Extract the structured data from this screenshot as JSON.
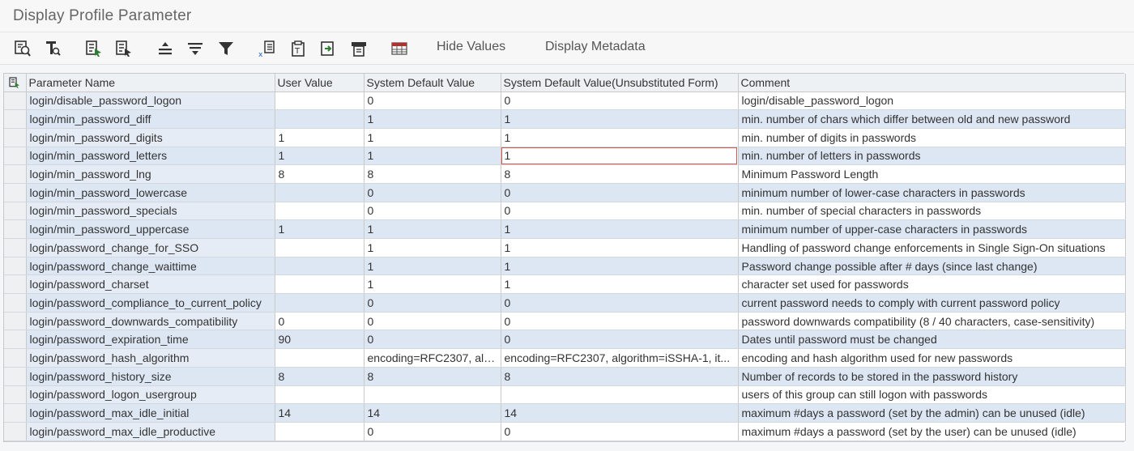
{
  "window": {
    "title": "Display Profile Parameter"
  },
  "toolbar": {
    "icons": [
      "details-icon",
      "text-search-icon",
      "select-layout-icon",
      "choose-layout-icon",
      "sort-ascending-icon",
      "sort-descending-icon",
      "filter-icon",
      "export-excel-icon",
      "print-preview-icon",
      "export-file-icon",
      "print-icon",
      "spreadsheet-icon"
    ],
    "hide_values": "Hide Values",
    "display_metadata": "Display Metadata"
  },
  "table": {
    "headers": {
      "name": "Parameter Name",
      "user": "User Value",
      "sys": "System Default Value",
      "unsub": "System Default Value(Unsubstituted Form)",
      "comment": "Comment"
    },
    "rows": [
      {
        "name": "login/disable_password_logon",
        "user": "",
        "sys": "0",
        "unsub": "0",
        "comment": "login/disable_password_logon"
      },
      {
        "name": "login/min_password_diff",
        "user": "",
        "sys": "1",
        "unsub": "1",
        "comment": "min. number of chars which differ between old and new password"
      },
      {
        "name": "login/min_password_digits",
        "user": "1",
        "sys": "1",
        "unsub": "1",
        "comment": "min. number of digits in passwords"
      },
      {
        "name": "login/min_password_letters",
        "user": "1",
        "sys": "1",
        "unsub": "1",
        "comment": "min. number of letters in passwords"
      },
      {
        "name": "login/min_password_lng",
        "user": "8",
        "sys": "8",
        "unsub": "8",
        "comment": "Minimum Password Length"
      },
      {
        "name": "login/min_password_lowercase",
        "user": "",
        "sys": "0",
        "unsub": "0",
        "comment": "minimum number of lower-case characters in passwords"
      },
      {
        "name": "login/min_password_specials",
        "user": "",
        "sys": "0",
        "unsub": "0",
        "comment": "min. number of special characters in passwords"
      },
      {
        "name": "login/min_password_uppercase",
        "user": "1",
        "sys": "1",
        "unsub": "1",
        "comment": "minimum number of upper-case characters in passwords"
      },
      {
        "name": "login/password_change_for_SSO",
        "user": "",
        "sys": "1",
        "unsub": "1",
        "comment": "Handling of password change enforcements in Single Sign-On situations"
      },
      {
        "name": "login/password_change_waittime",
        "user": "",
        "sys": "1",
        "unsub": "1",
        "comment": "Password change possible after # days (since last change)"
      },
      {
        "name": "login/password_charset",
        "user": "",
        "sys": "1",
        "unsub": "1",
        "comment": "character set used for passwords"
      },
      {
        "name": "login/password_compliance_to_current_policy",
        "user": "",
        "sys": "0",
        "unsub": "0",
        "comment": "current password needs to comply with current password policy"
      },
      {
        "name": "login/password_downwards_compatibility",
        "user": "0",
        "sys": "0",
        "unsub": "0",
        "comment": "password downwards compatibility (8 / 40 characters, case-sensitivity)"
      },
      {
        "name": "login/password_expiration_time",
        "user": "90",
        "sys": "0",
        "unsub": "0",
        "comment": "Dates until password must be changed"
      },
      {
        "name": "login/password_hash_algorithm",
        "user": "",
        "sys": "encoding=RFC2307, alg...",
        "unsub": "encoding=RFC2307, algorithm=iSSHA-1, it...",
        "comment": "encoding and hash algorithm used for new passwords"
      },
      {
        "name": "login/password_history_size",
        "user": "8",
        "sys": "8",
        "unsub": "8",
        "comment": "Number of records to be stored in the password history"
      },
      {
        "name": "login/password_logon_usergroup",
        "user": "",
        "sys": "",
        "unsub": "",
        "comment": "users of this group can still logon with passwords"
      },
      {
        "name": "login/password_max_idle_initial",
        "user": "14",
        "sys": "14",
        "unsub": "14",
        "comment": "maximum #days a password (set by the admin) can be unused (idle)"
      },
      {
        "name": "login/password_max_idle_productive",
        "user": "",
        "sys": "0",
        "unsub": "0",
        "comment": "maximum #days a password (set by the user) can be unused (idle)"
      }
    ]
  }
}
